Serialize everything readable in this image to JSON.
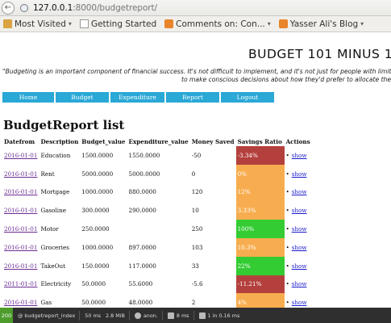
{
  "browser": {
    "back_glyph": "←",
    "url_host": "127.0.0.1",
    "url_path": ":8000/budgetreport/"
  },
  "bookmarks": [
    {
      "label": "Most Visited",
      "icon": "folder-icon",
      "caret": "▾"
    },
    {
      "label": "Getting Started",
      "icon": "page-icon",
      "caret": ""
    },
    {
      "label": "Comments on: Con...",
      "icon": "rss-icon",
      "caret": "▾"
    },
    {
      "label": "Yasser Ali's Blog",
      "icon": "rss-icon",
      "caret": "▾"
    }
  ],
  "site": {
    "title": "BUDGET 101 MINUS 1",
    "quote_line1": "\"Budgeting is an important component of financial success. It's not difficult to implement, and it's not just for people with limited fu",
    "quote_line2": "to make conscious decisions about how they'd prefer to allocate their m"
  },
  "nav": [
    {
      "label": "Home"
    },
    {
      "label": "Budget"
    },
    {
      "label": "Expenditure"
    },
    {
      "label": "Report"
    },
    {
      "label": "Logout"
    }
  ],
  "report": {
    "heading": "BudgetReport list",
    "columns": [
      "Datefrom",
      "Description",
      "Budget_value",
      "Expenditure_value",
      "Money Saved",
      "Savings Ratio",
      "Actions"
    ],
    "rows": [
      {
        "date": "2016-01-01",
        "description": "Education",
        "budget": "1500.0000",
        "expenditure": "1550.0000",
        "saved": "-50",
        "ratio": "-3.34%",
        "ratio_level": "neg",
        "action": "show"
      },
      {
        "date": "2016-01-01",
        "description": "Rent",
        "budget": "5000.0000",
        "expenditure": "5000.0000",
        "saved": "0",
        "ratio": "0%",
        "ratio_level": "low",
        "action": "show"
      },
      {
        "date": "2016-01-01",
        "description": "Mortgage",
        "budget": "1000.0000",
        "expenditure": "880.0000",
        "saved": "120",
        "ratio": "12%",
        "ratio_level": "low",
        "action": "show"
      },
      {
        "date": "2016-01-01",
        "description": "Gasoline",
        "budget": "300.0000",
        "expenditure": "290.0000",
        "saved": "10",
        "ratio": "3.33%",
        "ratio_level": "low",
        "action": "show"
      },
      {
        "date": "2016-01-01",
        "description": "Motor",
        "budget": "250.0000",
        "expenditure": "",
        "saved": "250",
        "ratio": "100%",
        "ratio_level": "high",
        "action": "show"
      },
      {
        "date": "2016-01-01",
        "description": "Groceries",
        "budget": "1000.0000",
        "expenditure": "897.0000",
        "saved": "103",
        "ratio": "10.3%",
        "ratio_level": "low",
        "action": "show"
      },
      {
        "date": "2016-01-01",
        "description": "TakeOut",
        "budget": "150.0000",
        "expenditure": "117.0000",
        "saved": "33",
        "ratio": "22%",
        "ratio_level": "high",
        "action": "show"
      },
      {
        "date": "2011-01-01",
        "description": "Electricity",
        "budget": "50.0000",
        "expenditure": "55.6000",
        "saved": "-5.6",
        "ratio": "-11.21%",
        "ratio_level": "neg",
        "action": "show"
      },
      {
        "date": "2016-01-01",
        "description": "Gas",
        "budget": "50.0000",
        "expenditure": "48.0000",
        "saved": "2",
        "ratio": "4%",
        "ratio_level": "low",
        "action": "show"
      }
    ]
  },
  "debugbar": {
    "status": "200",
    "route": "@ budgetreport_index",
    "time": "50 ms",
    "memory": "2.8 MiB",
    "user": "anon.",
    "render_time": "8 ms",
    "db": "1 in 0.16 ms"
  },
  "colors": {
    "nav_button": "#2aa8d6",
    "ratio_negative": "#b4403d",
    "ratio_low": "#f7ad4f",
    "ratio_high": "#33cc33",
    "debug_status_ok": "#4d9c2c"
  }
}
